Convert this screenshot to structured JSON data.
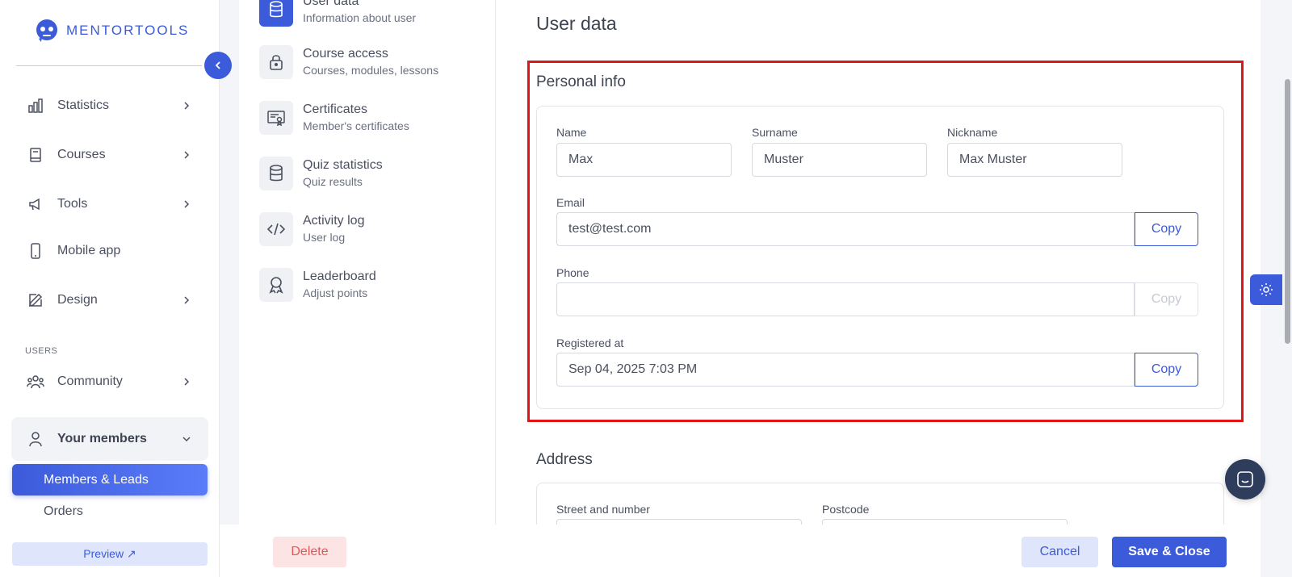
{
  "brand": {
    "name": "MENTORTOOLS",
    "color": "#3b5bdb"
  },
  "sidebar": {
    "items": [
      {
        "label": "Statistics",
        "icon": "bar-chart-icon"
      },
      {
        "label": "Courses",
        "icon": "book-icon"
      },
      {
        "label": "Tools",
        "icon": "megaphone-icon"
      },
      {
        "label": "Mobile app",
        "icon": "phone-icon"
      },
      {
        "label": "Design",
        "icon": "pencil-icon"
      }
    ],
    "section_users": "USERS",
    "community": {
      "label": "Community",
      "icon": "community-icon"
    },
    "your_members": {
      "label": "Your members",
      "icon": "user-icon"
    },
    "sub_items": [
      "Members & Leads",
      "Orders"
    ],
    "preview_label": "Preview ↗"
  },
  "tabs": [
    {
      "title": "User data",
      "subtitle": "Information about user",
      "icon": "database-icon"
    },
    {
      "title": "Course access",
      "subtitle": "Courses, modules, lessons",
      "icon": "lock-icon"
    },
    {
      "title": "Certificates",
      "subtitle": "Member's certificates",
      "icon": "certificate-icon"
    },
    {
      "title": "Quiz statistics",
      "subtitle": "Quiz results",
      "icon": "database-icon"
    },
    {
      "title": "Activity log",
      "subtitle": "User log",
      "icon": "code-icon"
    },
    {
      "title": "Leaderboard",
      "subtitle": "Adjust points",
      "icon": "award-icon"
    }
  ],
  "main": {
    "title": "User data",
    "personal": {
      "title": "Personal info",
      "name_label": "Name",
      "name_value": "Max",
      "surname_label": "Surname",
      "surname_value": "Muster",
      "nickname_label": "Nickname",
      "nickname_value": "Max Muster",
      "email_label": "Email",
      "email_value": "test@test.com",
      "phone_label": "Phone",
      "phone_value": "",
      "registered_label": "Registered at",
      "registered_value": "Sep 04, 2025 7:03 PM",
      "copy_label": "Copy"
    },
    "address": {
      "title": "Address",
      "street_label": "Street and number",
      "postcode_label": "Postcode"
    }
  },
  "footer": {
    "delete_label": "Delete",
    "cancel_label": "Cancel",
    "save_label": "Save & Close"
  }
}
